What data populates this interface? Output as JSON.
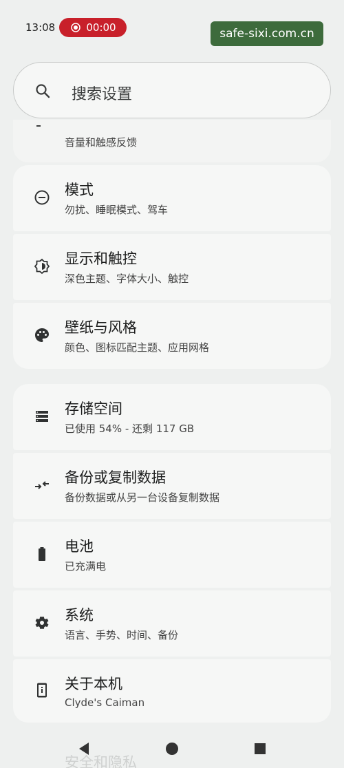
{
  "status_bar": {
    "time": "13:08",
    "recording_time": "00:00",
    "watermark": "safe-sixi.com.cn"
  },
  "search": {
    "placeholder": "搜索设置"
  },
  "settings_items": [
    {
      "title": "",
      "subtitle": "音量和触感反馈",
      "icon": "sound-icon"
    },
    {
      "title": "模式",
      "subtitle": "勿扰、睡眠模式、驾车",
      "icon": "minus-circle-icon"
    },
    {
      "title": "显示和触控",
      "subtitle": "深色主题、字体大小、触控",
      "icon": "brightness-icon"
    },
    {
      "title": "壁纸与风格",
      "subtitle": "颜色、图标匹配主题、应用网格",
      "icon": "palette-icon"
    },
    {
      "title": "存储空间",
      "subtitle": "已使用 54% - 还剩 117 GB",
      "icon": "storage-icon"
    },
    {
      "title": "备份或复制数据",
      "subtitle": "备份数据或从另一台设备复制数据",
      "icon": "transfer-icon"
    },
    {
      "title": "电池",
      "subtitle": "已充满电",
      "icon": "battery-icon"
    },
    {
      "title": "系统",
      "subtitle": "语言、手势、时间、备份",
      "icon": "gear-icon"
    },
    {
      "title": "关于本机",
      "subtitle": "Clyde's Caiman",
      "icon": "info-phone-icon"
    },
    {
      "title": "安全和隐私",
      "subtitle": "",
      "icon": "shield-icon"
    }
  ],
  "nav": {
    "back_icon": "back-triangle-icon",
    "home_icon": "home-circle-icon",
    "recents_icon": "recents-square-icon"
  }
}
